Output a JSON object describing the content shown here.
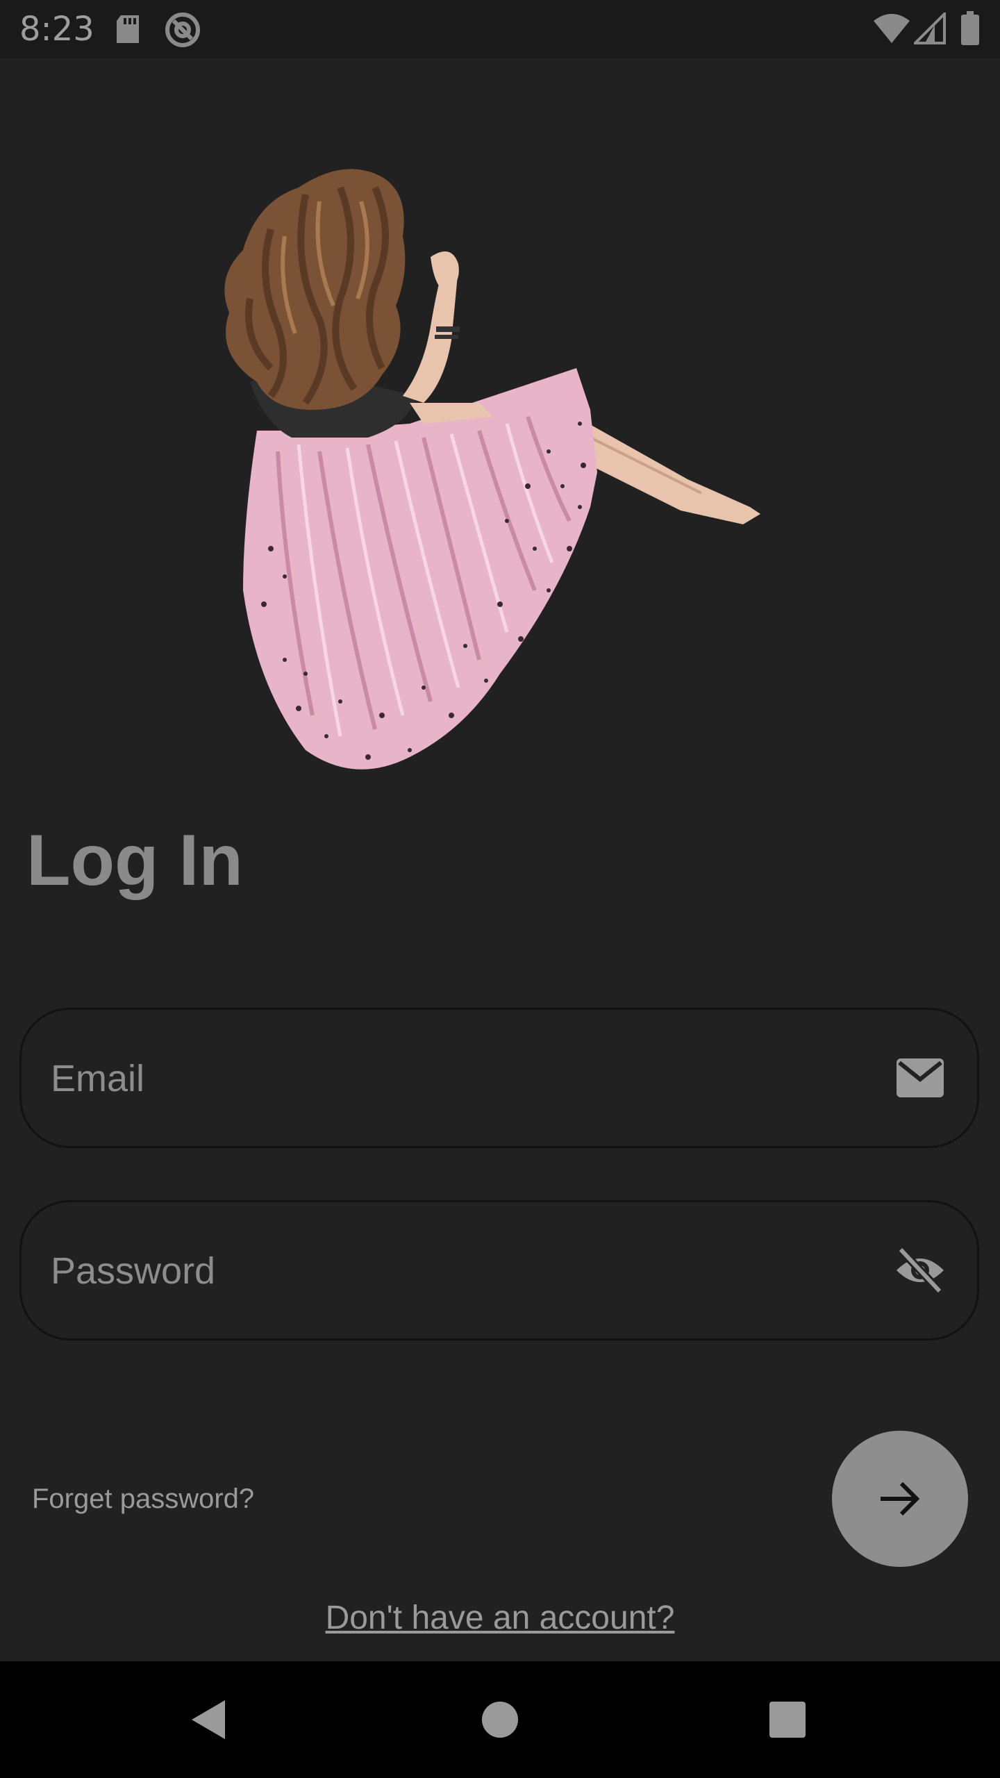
{
  "status_bar": {
    "time": "8:23",
    "left_icons": [
      "sd-card-icon",
      "sync-icon"
    ],
    "right_icons": [
      "wifi-icon",
      "signal-icon",
      "battery-icon"
    ]
  },
  "illustration": {
    "icon": "girl-illustration"
  },
  "page": {
    "title": "Log In"
  },
  "email_field": {
    "placeholder": "Email",
    "value": "",
    "icon": "mail-icon"
  },
  "password_field": {
    "placeholder": "Password",
    "value": "",
    "icon": "visibility-off-icon"
  },
  "links": {
    "forgot_password": "Forget password?",
    "signup": "Don't have an account?"
  },
  "fab": {
    "icon": "arrow-right-icon"
  },
  "nav_bar": {
    "icons": [
      "back-icon",
      "home-icon",
      "recents-icon"
    ]
  },
  "colors": {
    "background": "#212121",
    "status_bar": "#1a1a1a",
    "fab": "#8e8e8e",
    "text_muted": "#9a9a9a",
    "skirt": "#e8b4c8"
  }
}
